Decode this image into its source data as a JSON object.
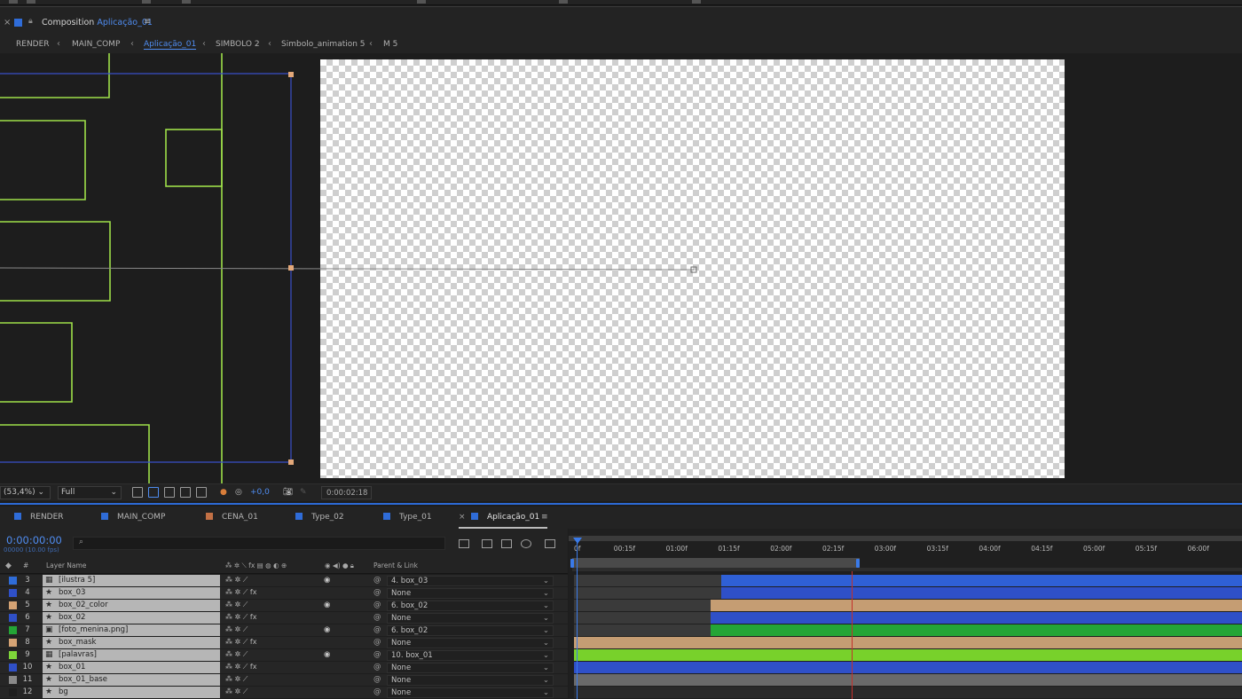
{
  "panel": {
    "prefix": "Composition",
    "name": "Aplicação_01"
  },
  "breadcrumbs": [
    "RENDER",
    "MAIN_COMP",
    "Aplicação_01",
    "SIMBOLO 2",
    "Simbolo_animation 5",
    "M 5"
  ],
  "viewer_toolbar": {
    "zoom": "(53,4%)",
    "resolution": "Full",
    "exposure": "+0,0",
    "timecode": "0:00:02:18"
  },
  "timeline_tabs": [
    {
      "label": "RENDER",
      "color": "#2f6cd8"
    },
    {
      "label": "MAIN_COMP",
      "color": "#2f6cd8"
    },
    {
      "label": "CENA_01",
      "color": "#c27045"
    },
    {
      "label": "Type_02",
      "color": "#2f6cd8"
    },
    {
      "label": "Type_01",
      "color": "#2f6cd8"
    },
    {
      "label": "Aplicação_01",
      "color": "#2f6cd8"
    }
  ],
  "timeline": {
    "current_time": "0:00:00:00",
    "fps": "00000 (10.00 fps)",
    "columns": {
      "layer_name": "Layer Name",
      "parent": "Parent & Link",
      "hash": "#"
    },
    "ruler": [
      "0f",
      "00:15f",
      "01:00f",
      "01:15f",
      "02:00f",
      "02:15f",
      "03:00f",
      "03:15f",
      "04:00f",
      "04:15f",
      "05:00f",
      "05:15f",
      "06:00f"
    ]
  },
  "layers": [
    {
      "num": "3",
      "name": "[ilustra 5]",
      "type": "precomp",
      "label_color": "#2f6cd8",
      "fx": false,
      "eye": true,
      "parent": "4. box_03",
      "bar_start": 0.22,
      "bar_color": "#2f60d6"
    },
    {
      "num": "4",
      "name": "box_03",
      "type": "shape",
      "label_color": "#2f50c8",
      "fx": true,
      "eye": false,
      "parent": "None",
      "bar_start": 0.22,
      "bar_color": "#2f50c8"
    },
    {
      "num": "5",
      "name": "box_02_color",
      "type": "shape",
      "label_color": "#d5a374",
      "fx": false,
      "eye": true,
      "parent": "6. box_02",
      "bar_start": 0.205,
      "bar_color": "#c59d73"
    },
    {
      "num": "6",
      "name": "box_02",
      "type": "shape",
      "label_color": "#2f50c8",
      "fx": true,
      "eye": false,
      "parent": "None",
      "bar_start": 0.205,
      "bar_color": "#2f50c8"
    },
    {
      "num": "7",
      "name": "[foto_menina.png]",
      "type": "image",
      "label_color": "#24a536",
      "fx": false,
      "eye": true,
      "parent": "6. box_02",
      "bar_start": 0.205,
      "bar_color": "#24a536"
    },
    {
      "num": "8",
      "name": "box_mask",
      "type": "shape",
      "label_color": "#d5a374",
      "fx": true,
      "eye": false,
      "parent": "None",
      "bar_start": 0.0,
      "bar_color": "#c59d73"
    },
    {
      "num": "9",
      "name": "[palavras]",
      "type": "precomp",
      "label_color": "#7ed63a",
      "fx": false,
      "eye": true,
      "parent": "10. box_01",
      "bar_start": 0.0,
      "bar_color": "#78d12b"
    },
    {
      "num": "10",
      "name": "box_01",
      "type": "shape",
      "label_color": "#2f50c8",
      "fx": true,
      "eye": false,
      "parent": "None",
      "bar_start": 0.0,
      "bar_color": "#2f50c8"
    },
    {
      "num": "11",
      "name": "box_01_base",
      "type": "shape",
      "label_color": "#8a8a8a",
      "fx": false,
      "eye": false,
      "parent": "None",
      "bar_start": 0.0,
      "bar_color": "#6a6a6a"
    },
    {
      "num": "12",
      "name": "bg",
      "type": "shape",
      "label_color": "#1f1f1f",
      "fx": false,
      "eye": false,
      "parent": "None",
      "bar_start": 0.0,
      "bar_color": "#2a2a2a"
    }
  ],
  "icons": {
    "close": "close-icon",
    "lock": "lock-icon",
    "menu": "menu-icon",
    "search": "search-icon",
    "camera": "camera-icon",
    "eye": "eye-icon",
    "star": "shape-layer-icon",
    "spiral": "pick-whip-icon"
  }
}
